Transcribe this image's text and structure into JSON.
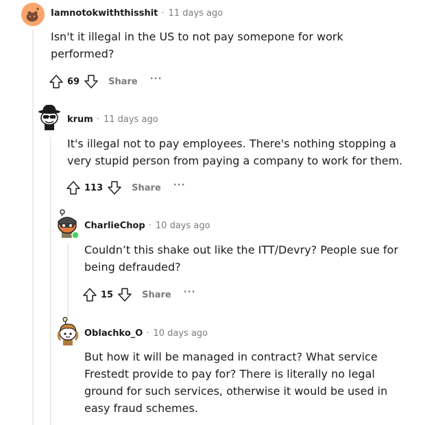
{
  "comments": [
    {
      "username": "Iamnotokwiththisshit",
      "separator": "·",
      "time": "11 days ago",
      "body_lines": [
        "Isn't it illegal in the US to not pay somepone for work",
        "performed?"
      ],
      "votes": "69",
      "share_label": "Share",
      "more_label": "···"
    },
    {
      "username": "krum",
      "separator": "·",
      "time": "11 days ago",
      "body_lines": [
        "It's illegal not to pay employees. There's nothing stopping a",
        "very stupid person from paying a company to work for them."
      ],
      "votes": "113",
      "share_label": "Share",
      "more_label": "···"
    },
    {
      "username": "CharlieChop",
      "separator": "·",
      "time": "10 days ago",
      "body_lines": [
        "Couldn’t this shake out like the ITT/Devry? People sue for",
        "being defrauded?"
      ],
      "votes": "15",
      "share_label": "Share",
      "more_label": "···",
      "online": true
    },
    {
      "username": "Oblachko_O",
      "separator": "·",
      "time": "10 days ago",
      "body_lines": [
        "But how it will be managed in contract? What service",
        "Frestedt provide to pay for? There is literally no legal",
        "ground for such services, otherwise it would be used in",
        "easy fraud schemes."
      ]
    }
  ],
  "icons": {
    "upvote": "upvote-arrow-icon",
    "downvote": "downvote-arrow-icon"
  },
  "colors": {
    "meta_gray": "#7c7c7c",
    "thread_line": "#e9ebed",
    "online_green": "#46d160",
    "avatar1_bg": "#f7a56c"
  }
}
